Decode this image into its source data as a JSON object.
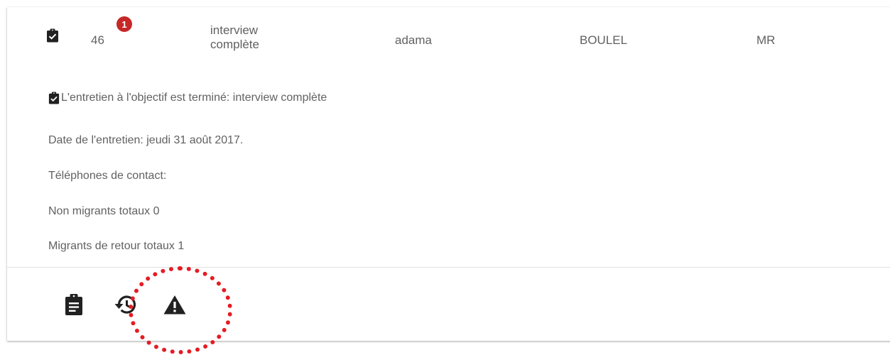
{
  "row": {
    "id": "46",
    "badge_count": "1",
    "status_line1": "interview",
    "status_line2": "complète",
    "first_name": "adama",
    "last_name": "BOULEL",
    "title": "MR"
  },
  "details": {
    "objective_status": "L'entretien à l'objectif est terminé: interview complète",
    "interview_date": "Date de l'entretien: jeudi 31 août 2017.",
    "contact_phones": "Téléphones de contact:",
    "non_migrants": "Non migrants totaux 0",
    "return_migrants": "Migrants de retour totaux 1"
  },
  "actions": [
    {
      "icon": "clipboard-icon"
    },
    {
      "icon": "history-icon"
    },
    {
      "icon": "warning-icon"
    }
  ],
  "colors": {
    "badge": "#c62828",
    "highlight": "#e51c23",
    "icon": "#212121",
    "text": "#616161"
  }
}
